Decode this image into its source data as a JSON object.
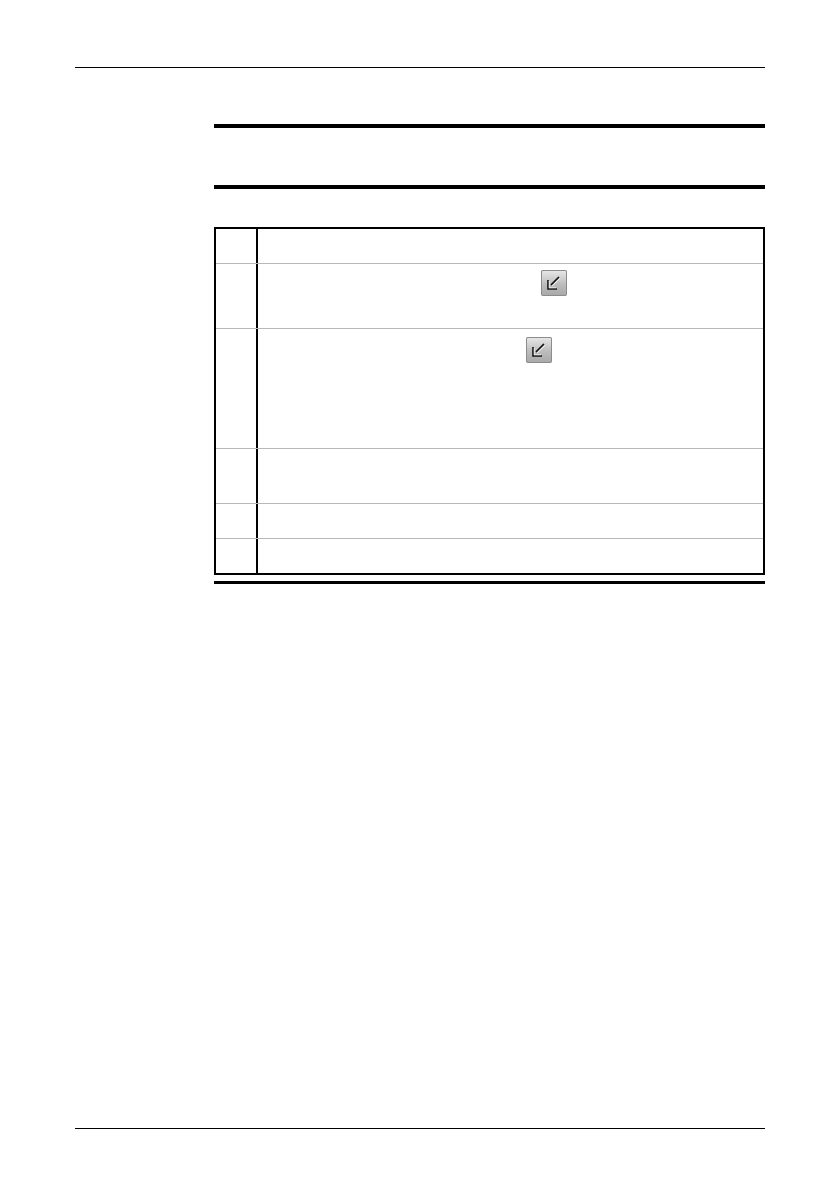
{
  "page": {
    "note": {},
    "steps": [
      {
        "number": "",
        "text": ""
      },
      {
        "number": "",
        "text": "",
        "icon": "arrow-down-left-icon"
      },
      {
        "number": "",
        "text": "",
        "icon": "arrow-down-left-icon"
      },
      {
        "number": "",
        "text": ""
      },
      {
        "number": "",
        "text": ""
      },
      {
        "number": "",
        "text": ""
      }
    ]
  }
}
